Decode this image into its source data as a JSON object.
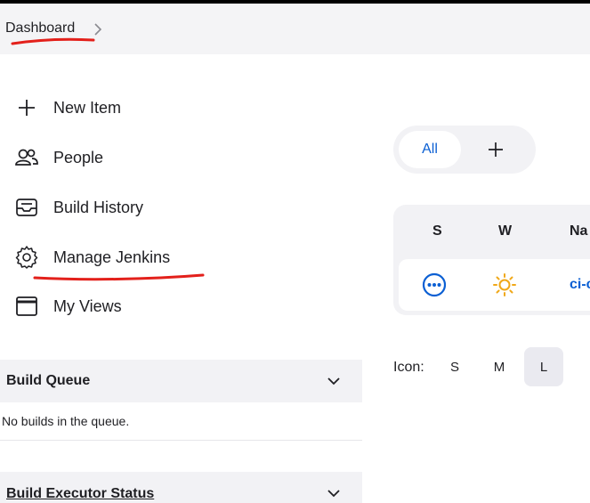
{
  "breadcrumb": {
    "label": "Dashboard"
  },
  "tasks": [
    {
      "label": "New Item",
      "icon": "plus-icon"
    },
    {
      "label": "People",
      "icon": "people-icon"
    },
    {
      "label": "Build History",
      "icon": "inbox-icon"
    },
    {
      "label": "Manage Jenkins",
      "icon": "gear-icon"
    },
    {
      "label": "My Views",
      "icon": "window-icon"
    }
  ],
  "build_queue": {
    "title": "Build Queue",
    "empty_text": "No builds in the queue."
  },
  "executor_status": {
    "title": "Build Executor Status"
  },
  "view_tabs": {
    "all": "All",
    "add_icon": "plus-icon"
  },
  "jobs_table": {
    "headers": {
      "status": "S",
      "weather": "W",
      "name": "Na"
    },
    "rows": [
      {
        "status_icon": "in-progress-icon",
        "weather_icon": "sun-icon",
        "name": "ci-c"
      }
    ]
  },
  "icon_size": {
    "label": "Icon:",
    "options": [
      "S",
      "M",
      "L"
    ],
    "selected": "L"
  },
  "colors": {
    "link": "#0b5fd3",
    "weather_sun": "#f0a818",
    "annotation": "#e3201b"
  }
}
